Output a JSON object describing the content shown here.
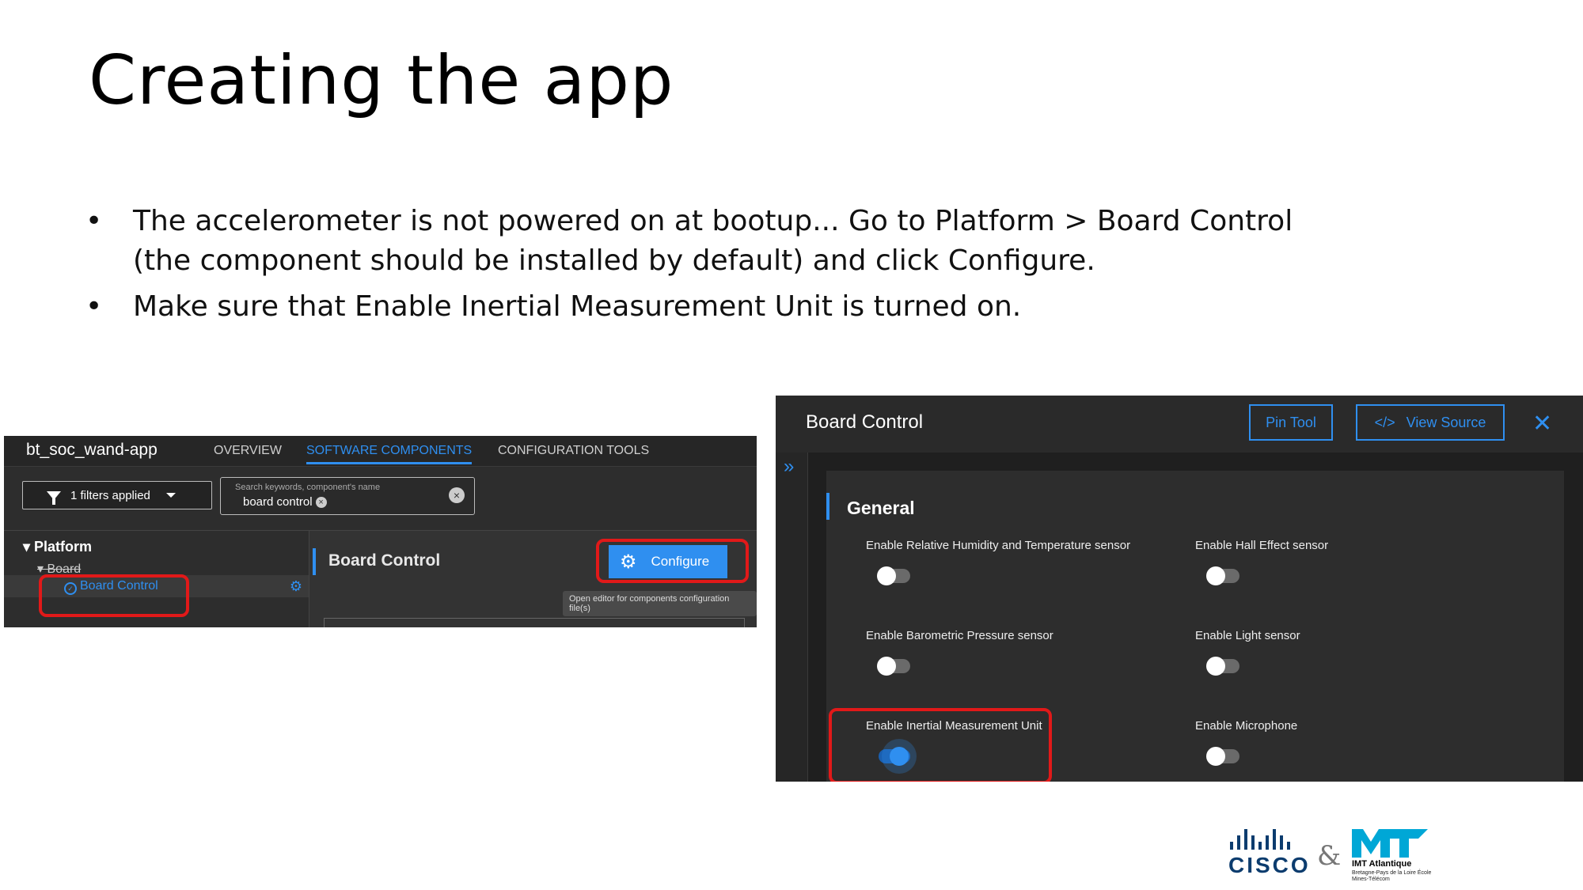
{
  "slide": {
    "title": "Creating the app",
    "bullets": [
      "The accelerometer is not powered on at bootup... Go to Platform > Board Control (the component should be installed by default) and click Configure.",
      "Make sure that Enable Inertial Measurement Unit is turned on."
    ],
    "bullet_glyph": "•"
  },
  "left_shot": {
    "app_name": "bt_soc_wand-app",
    "tabs": [
      {
        "label": "OVERVIEW",
        "active": false
      },
      {
        "label": "SOFTWARE COMPONENTS",
        "active": true
      },
      {
        "label": "CONFIGURATION TOOLS",
        "active": false
      }
    ],
    "filter_label": "1 filters applied",
    "search": {
      "placeholder": "Search keywords, component's name",
      "value": "board control"
    },
    "tree": {
      "platform": "▾ Platform",
      "board": "▾ Board",
      "board_control": "Board Control"
    },
    "panel": {
      "title": "Board Control",
      "configure_label": "Configure",
      "tooltip": "Open editor for components configuration file(s)"
    }
  },
  "right_shot": {
    "title": "Board Control",
    "pin_tool_label": "Pin Tool",
    "view_source_label": "View Source",
    "view_source_icon": "</>",
    "close_icon": "✕",
    "expand_icon": "»",
    "section": "General",
    "options": [
      {
        "label": "Enable Relative Humidity and Temperature sensor",
        "on": false
      },
      {
        "label": "Enable Hall Effect sensor",
        "on": false
      },
      {
        "label": "Enable Barometric Pressure sensor",
        "on": false
      },
      {
        "label": "Enable Light sensor",
        "on": false
      },
      {
        "label": "Enable Inertial Measurement Unit",
        "on": true
      },
      {
        "label": "Enable Microphone",
        "on": false
      }
    ]
  },
  "logos": {
    "cisco": "CISCO",
    "ampersand": "&",
    "imt_name": "IMT Atlantique",
    "imt_sub": "Bretagne-Pays de la Loire École Mines-Télécom"
  },
  "colors": {
    "accent": "#2f8ff0",
    "highlight": "#e11919",
    "dark_bg": "#2d2d2d"
  }
}
